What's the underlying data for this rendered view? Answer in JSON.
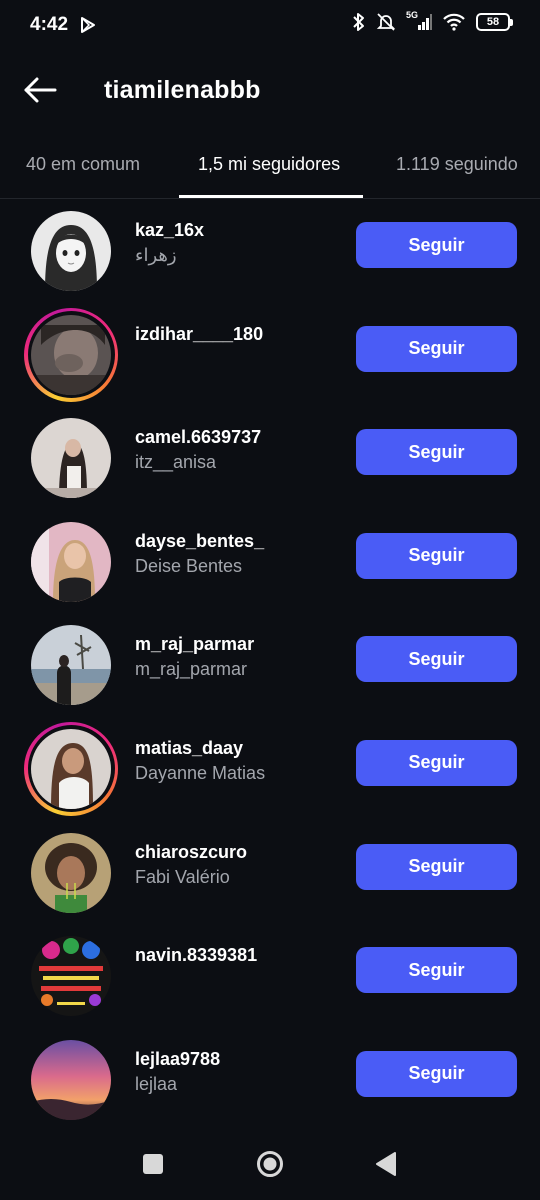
{
  "status_bar": {
    "time": "4:42",
    "network": "5G",
    "battery": "58",
    "icons": [
      "play-store-icon",
      "bluetooth-icon",
      "mute-icon",
      "signal-icon",
      "wifi-icon",
      "battery-icon"
    ]
  },
  "header": {
    "title": "tiamilenabbb",
    "back_icon": "arrow-left-icon"
  },
  "tabs": [
    {
      "label": "40 em comum",
      "active": false
    },
    {
      "label": "1,5 mi seguidores",
      "active": true
    },
    {
      "label": "1.119 seguindo",
      "active": false
    }
  ],
  "users": [
    {
      "username": "kaz_16x",
      "name": "زهراء",
      "follow_label": "Seguir",
      "has_story": false
    },
    {
      "username": "izdihar____180",
      "name": "",
      "follow_label": "Seguir",
      "has_story": true
    },
    {
      "username": "camel.6639737",
      "name": "itz__anisa",
      "follow_label": "Seguir",
      "has_story": false
    },
    {
      "username": "dayse_bentes_",
      "name": "Deise Bentes",
      "follow_label": "Seguir",
      "has_story": false
    },
    {
      "username": "m_raj_parmar",
      "name": "m_raj_parmar",
      "follow_label": "Seguir",
      "has_story": false
    },
    {
      "username": "matias_daay",
      "name": "Dayanne Matias",
      "follow_label": "Seguir",
      "has_story": true
    },
    {
      "username": "chiaroszcuro",
      "name": "Fabi Valério",
      "follow_label": "Seguir",
      "has_story": false
    },
    {
      "username": "navin.8339381",
      "name": "",
      "follow_label": "Seguir",
      "has_story": false
    },
    {
      "username": "lejlaa9788",
      "name": "lejlaa",
      "follow_label": "Seguir",
      "has_story": false
    }
  ],
  "colors": {
    "background": "#0c0e13",
    "follow_button": "#4a5cf6",
    "secondary_text": "#a3a6ad",
    "story_ring": [
      "#f9ce34",
      "#ee2a7b",
      "#c2199b"
    ]
  },
  "nav_bar": {
    "icons": [
      "recents-square-icon",
      "home-circle-icon",
      "back-triangle-icon"
    ]
  }
}
